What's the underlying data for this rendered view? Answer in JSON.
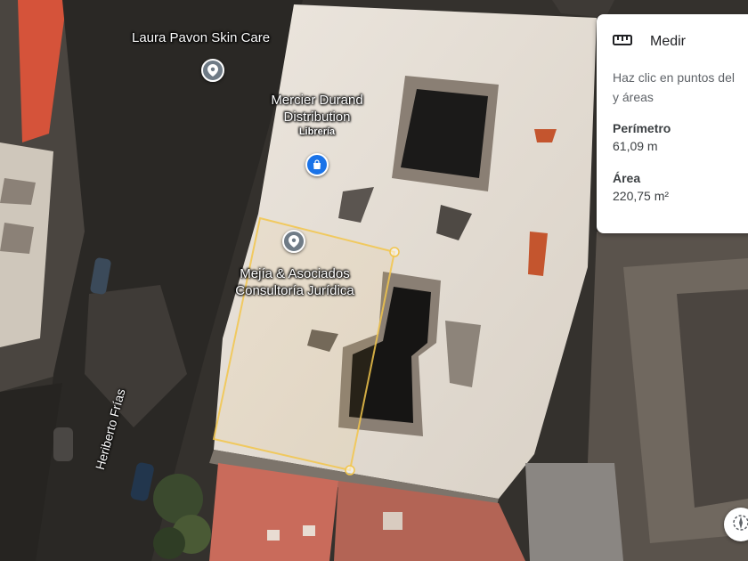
{
  "map": {
    "places": [
      {
        "name": "Laura Pavon Skin Care",
        "category": "",
        "pin": "gray-location-pin-icon"
      },
      {
        "name_lines": [
          "Mercier Durand",
          "Distribution"
        ],
        "category": "Librería",
        "pin": "blue-shopping-bag-pin-icon"
      },
      {
        "name_lines": [
          "Mejía & Asociados",
          "Consultoría Jurídica"
        ],
        "category": "",
        "pin": "gray-location-pin-icon"
      }
    ],
    "street": "Heriberto Frías",
    "measurement_line_color": "#f2c54b",
    "pin_colors": {
      "gray": "#6f7b86",
      "blue": "#1a73e8"
    }
  },
  "measure_panel": {
    "title": "Medir",
    "icon": "ruler-icon",
    "instructions": "Haz clic en puntos del mapa para medir distancias y áreas",
    "instruction_line1": "Haz clic en puntos del",
    "instruction_line2": "y áreas",
    "perimeter_label": "Perímetro",
    "perimeter_value": "61,09 m",
    "area_label": "Área",
    "area_value": "220,75 m²"
  }
}
